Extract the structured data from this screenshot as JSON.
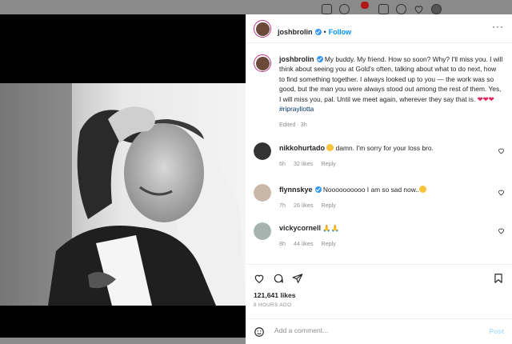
{
  "top_icons": [
    "home-icon",
    "messenger-icon",
    "new-post-icon",
    "explore-icon",
    "activity-icon",
    "avatar"
  ],
  "notification_badge": "1",
  "post": {
    "username": "joshbrolin",
    "follow_label": "Follow",
    "separator": "•",
    "caption_user": "joshbrolin",
    "caption_text": " My buddy. My friend. How so soon? Why? I'll miss you. I will think about seeing you at Gold's often, talking about what to do next, how to find something together. I always looked up to you — the work was so good, but the man you were always stood out among the rest of them. Yes, I will miss you, pal. Until we meet again, wherever they say that is. ",
    "caption_hearts": "❤❤❤",
    "hashtag": "#riprayliotta",
    "caption_meta": "Edited · 3h",
    "likes": "121,641 likes",
    "time_ago": "8 HOURS AGO",
    "add_comment_placeholder": "Add a comment...",
    "post_label": "Post"
  },
  "comments": [
    {
      "user": "nikkohurtado",
      "emoji_before": true,
      "text": " damn. I'm sorry for your loss bro.",
      "time": "6h",
      "likes": "32 likes",
      "reply": "Reply",
      "verified": false
    },
    {
      "user": "flynnskye",
      "emoji_after": true,
      "text": "Noooooooooo I am so sad now..",
      "time": "7h",
      "likes": "26 likes",
      "reply": "Reply",
      "verified": true
    },
    {
      "user": "vickycornell",
      "text": "🙏🙏",
      "time": "8h",
      "likes": "44 likes",
      "reply": "Reply",
      "verified": false
    }
  ],
  "colors": {
    "accent": "#0095f6",
    "text": "#262626",
    "muted": "#8e8e8e",
    "heart": "#e0245e"
  }
}
